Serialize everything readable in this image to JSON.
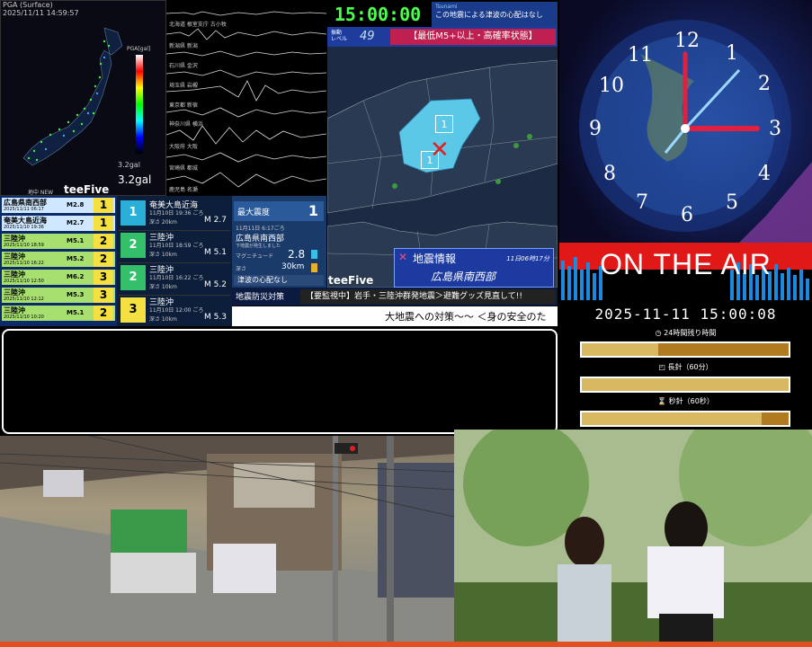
{
  "seismo": {
    "pga_title": "PGA (Surface)",
    "pga_time": "2025/11/11 14:59:57",
    "pga_value": "3.2gal",
    "pga_value2": "3.2gal",
    "legend_title": "PGA[gal]",
    "shindo_label": "地中 NEW",
    "brand": "teeFive",
    "wave_stations": [
      "北海道 根室支庁 古小牧",
      "新潟県 新潟",
      "石川県 金沢",
      "埼玉県 岩槻",
      "東京都 新宿",
      "神奈川県 横浜",
      "大阪府 大阪",
      "宮崎県 都城",
      "鹿児島 名瀬"
    ]
  },
  "eq_list": [
    {
      "name": "広島県南西部",
      "date": "2025/11/11 06:17",
      "mag": "M2.8",
      "int": "1"
    },
    {
      "name": "奄美大島近海",
      "date": "2025/11/10 19:36",
      "mag": "M2.7",
      "int": "1"
    },
    {
      "name": "三陸沖",
      "date": "2025/11/10 18:59",
      "mag": "M5.1",
      "int": "2"
    },
    {
      "name": "三陸沖",
      "date": "2025/11/10 16:22",
      "mag": "M5.2",
      "int": "2"
    },
    {
      "name": "三陸沖",
      "date": "2025/11/10 12:50",
      "mag": "M6.2",
      "int": "3"
    },
    {
      "name": "三陸沖",
      "date": "2025/11/10 12:12",
      "mag": "M5.3",
      "int": "3"
    },
    {
      "name": "三陸沖",
      "date": "2025/11/10 10:20",
      "mag": "M5.1",
      "int": "2"
    }
  ],
  "eq_detail": [
    {
      "int": "1",
      "name": "奄美大島近海",
      "time": "11月10日 19:36 ごろ",
      "depth": "深さ 20km",
      "mag": "M 2.7"
    },
    {
      "int": "2",
      "name": "三陸沖",
      "time": "11月10日 18:59 ごろ",
      "depth": "深さ 10km",
      "mag": "M 5.1"
    },
    {
      "int": "2",
      "name": "三陸沖",
      "time": "11月10日 16:22 ごろ",
      "depth": "深さ 10km",
      "mag": "M 5.2"
    },
    {
      "int": "3",
      "name": "三陸沖",
      "time": "11月10日 12:00 ごろ",
      "depth": "深さ 10km",
      "mag": "M 5.3"
    }
  ],
  "summary": {
    "max_label": "最大震度",
    "max_value": "1",
    "time": "11月11日 6:17ごろ",
    "place": "広島県南西部",
    "note": "下地震が発生しました",
    "mag_label": "マグニチュード",
    "mag_value": "2.8",
    "depth_label": "深さ",
    "depth_value": "30km",
    "tsunami": "津波の心配なし"
  },
  "map_panel": {
    "clock": "15:00:00",
    "tsunami_badge": "Tsunami",
    "tsunami_note": "この地震による津波の心配はなし",
    "level_label": "振動\nレベル",
    "level_value": "49",
    "alert": "【最低M5+以上・高確率状態】",
    "info_title": "地震情報",
    "info_time": "11日06時17分",
    "info_place": "広島県南西部",
    "brand": "teeFive"
  },
  "ticker": {
    "label": "地震防災対策",
    "text1": "【要監視中】岩手・三陸沖群発地震＞避難グッズ見直して!!",
    "text2": "大地震への対策〜〜 ＜身の安全のた"
  },
  "clock": {
    "on_air": "ON THE AIR",
    "datetime": "2025-11-11 15:00:08",
    "bar1_label": "24時間残り時間",
    "bar2_label": "長針（60分）",
    "bar3_label": "秒針（60秒）",
    "bar1_progress": 0.37,
    "bar2_progress": 1.0,
    "bar3_progress": 0.87,
    "numbers": [
      "12",
      "1",
      "2",
      "3",
      "4",
      "5",
      "6",
      "7",
      "8",
      "9",
      "10",
      "11"
    ]
  }
}
